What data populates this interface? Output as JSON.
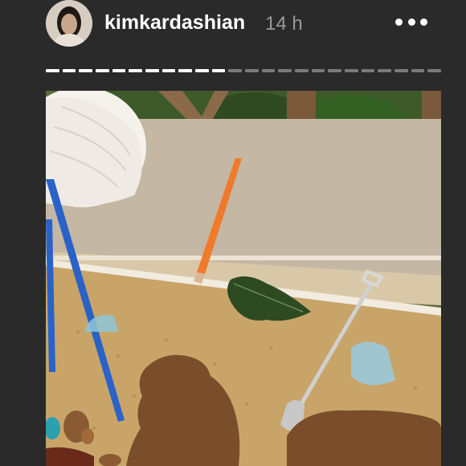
{
  "story": {
    "username": "kimkardashian",
    "timestamp": "14 h",
    "progress": {
      "segments_total": 24,
      "segments_viewed": 11,
      "viewed_color": "#ffffff",
      "remaining_color": "#7a7a7a"
    }
  },
  "colors": {
    "background": "#2a2a2a"
  },
  "icons": {
    "more": "more-horizontal-icon",
    "avatar": "profile-avatar"
  }
}
